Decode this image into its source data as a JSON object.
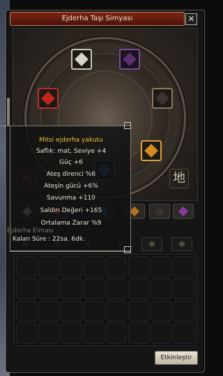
{
  "window": {
    "title": "Ejderha Taşı Simyası",
    "close_label": "✕"
  },
  "corner_glyphs": {
    "left": "天",
    "right": "地"
  },
  "tooltip": {
    "name": "Mitsi ejderha yakutu",
    "level": "Saflık: mat, Seviye +4",
    "stats": [
      "Güç +6",
      "Ateş direnci %6",
      "Ateşin gücü +6%",
      "Savunma +110",
      "Saldırı Değeri +165",
      "Ortalama Zarar %9"
    ],
    "section": "Ejderha Elması",
    "remaining": "Kalan Süre : 22sa. 6dk."
  },
  "buttons": {
    "activate": "Etkinleştir"
  },
  "slots": {
    "large": [
      {
        "id": "top-left",
        "gem": "diamond",
        "color": "#d8d4cc"
      },
      {
        "id": "top-right",
        "gem": "amethyst",
        "color": "#5b2f70"
      },
      {
        "id": "left",
        "gem": "ruby",
        "color": "#c2261b"
      },
      {
        "id": "right",
        "gem": "onyx",
        "color": "#3b342c"
      },
      {
        "id": "bottom-right",
        "gem": "garnet",
        "color": "#d48a1f"
      },
      {
        "id": "bottom",
        "gem": "sapphire",
        "color": "#2c5a9a"
      }
    ],
    "small": [
      {
        "gem": "diamond",
        "color": "#cfcac0"
      },
      {
        "gem": "ruby",
        "color": "#a12a22"
      },
      {
        "gem": "sapphire",
        "color": "#2b5d8a"
      },
      {
        "gem": "garnet",
        "color": "#b4701f"
      },
      {
        "gem": "onyx",
        "color": "#3a342e"
      },
      {
        "gem": "amethyst",
        "color": "#8a3aa0"
      }
    ],
    "sun_icons": [
      "☼",
      "☼",
      "☼",
      "☼",
      "☼",
      "☼"
    ]
  },
  "colors": {
    "title_bar": "#7a2414",
    "tooltip_name": "#e8c23a"
  }
}
